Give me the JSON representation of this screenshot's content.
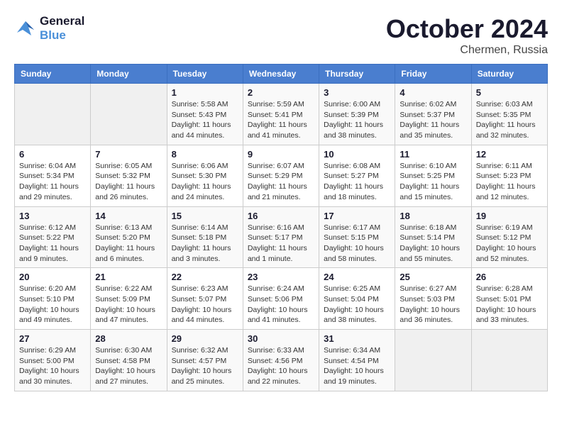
{
  "logo": {
    "line1": "General",
    "line2": "Blue"
  },
  "title": "October 2024",
  "location": "Chermen, Russia",
  "days_of_week": [
    "Sunday",
    "Monday",
    "Tuesday",
    "Wednesday",
    "Thursday",
    "Friday",
    "Saturday"
  ],
  "weeks": [
    [
      {
        "day": "",
        "info": ""
      },
      {
        "day": "",
        "info": ""
      },
      {
        "day": "1",
        "info": "Sunrise: 5:58 AM\nSunset: 5:43 PM\nDaylight: 11 hours and 44 minutes."
      },
      {
        "day": "2",
        "info": "Sunrise: 5:59 AM\nSunset: 5:41 PM\nDaylight: 11 hours and 41 minutes."
      },
      {
        "day": "3",
        "info": "Sunrise: 6:00 AM\nSunset: 5:39 PM\nDaylight: 11 hours and 38 minutes."
      },
      {
        "day": "4",
        "info": "Sunrise: 6:02 AM\nSunset: 5:37 PM\nDaylight: 11 hours and 35 minutes."
      },
      {
        "day": "5",
        "info": "Sunrise: 6:03 AM\nSunset: 5:35 PM\nDaylight: 11 hours and 32 minutes."
      }
    ],
    [
      {
        "day": "6",
        "info": "Sunrise: 6:04 AM\nSunset: 5:34 PM\nDaylight: 11 hours and 29 minutes."
      },
      {
        "day": "7",
        "info": "Sunrise: 6:05 AM\nSunset: 5:32 PM\nDaylight: 11 hours and 26 minutes."
      },
      {
        "day": "8",
        "info": "Sunrise: 6:06 AM\nSunset: 5:30 PM\nDaylight: 11 hours and 24 minutes."
      },
      {
        "day": "9",
        "info": "Sunrise: 6:07 AM\nSunset: 5:29 PM\nDaylight: 11 hours and 21 minutes."
      },
      {
        "day": "10",
        "info": "Sunrise: 6:08 AM\nSunset: 5:27 PM\nDaylight: 11 hours and 18 minutes."
      },
      {
        "day": "11",
        "info": "Sunrise: 6:10 AM\nSunset: 5:25 PM\nDaylight: 11 hours and 15 minutes."
      },
      {
        "day": "12",
        "info": "Sunrise: 6:11 AM\nSunset: 5:23 PM\nDaylight: 11 hours and 12 minutes."
      }
    ],
    [
      {
        "day": "13",
        "info": "Sunrise: 6:12 AM\nSunset: 5:22 PM\nDaylight: 11 hours and 9 minutes."
      },
      {
        "day": "14",
        "info": "Sunrise: 6:13 AM\nSunset: 5:20 PM\nDaylight: 11 hours and 6 minutes."
      },
      {
        "day": "15",
        "info": "Sunrise: 6:14 AM\nSunset: 5:18 PM\nDaylight: 11 hours and 3 minutes."
      },
      {
        "day": "16",
        "info": "Sunrise: 6:16 AM\nSunset: 5:17 PM\nDaylight: 11 hours and 1 minute."
      },
      {
        "day": "17",
        "info": "Sunrise: 6:17 AM\nSunset: 5:15 PM\nDaylight: 10 hours and 58 minutes."
      },
      {
        "day": "18",
        "info": "Sunrise: 6:18 AM\nSunset: 5:14 PM\nDaylight: 10 hours and 55 minutes."
      },
      {
        "day": "19",
        "info": "Sunrise: 6:19 AM\nSunset: 5:12 PM\nDaylight: 10 hours and 52 minutes."
      }
    ],
    [
      {
        "day": "20",
        "info": "Sunrise: 6:20 AM\nSunset: 5:10 PM\nDaylight: 10 hours and 49 minutes."
      },
      {
        "day": "21",
        "info": "Sunrise: 6:22 AM\nSunset: 5:09 PM\nDaylight: 10 hours and 47 minutes."
      },
      {
        "day": "22",
        "info": "Sunrise: 6:23 AM\nSunset: 5:07 PM\nDaylight: 10 hours and 44 minutes."
      },
      {
        "day": "23",
        "info": "Sunrise: 6:24 AM\nSunset: 5:06 PM\nDaylight: 10 hours and 41 minutes."
      },
      {
        "day": "24",
        "info": "Sunrise: 6:25 AM\nSunset: 5:04 PM\nDaylight: 10 hours and 38 minutes."
      },
      {
        "day": "25",
        "info": "Sunrise: 6:27 AM\nSunset: 5:03 PM\nDaylight: 10 hours and 36 minutes."
      },
      {
        "day": "26",
        "info": "Sunrise: 6:28 AM\nSunset: 5:01 PM\nDaylight: 10 hours and 33 minutes."
      }
    ],
    [
      {
        "day": "27",
        "info": "Sunrise: 6:29 AM\nSunset: 5:00 PM\nDaylight: 10 hours and 30 minutes."
      },
      {
        "day": "28",
        "info": "Sunrise: 6:30 AM\nSunset: 4:58 PM\nDaylight: 10 hours and 27 minutes."
      },
      {
        "day": "29",
        "info": "Sunrise: 6:32 AM\nSunset: 4:57 PM\nDaylight: 10 hours and 25 minutes."
      },
      {
        "day": "30",
        "info": "Sunrise: 6:33 AM\nSunset: 4:56 PM\nDaylight: 10 hours and 22 minutes."
      },
      {
        "day": "31",
        "info": "Sunrise: 6:34 AM\nSunset: 4:54 PM\nDaylight: 10 hours and 19 minutes."
      },
      {
        "day": "",
        "info": ""
      },
      {
        "day": "",
        "info": ""
      }
    ]
  ]
}
